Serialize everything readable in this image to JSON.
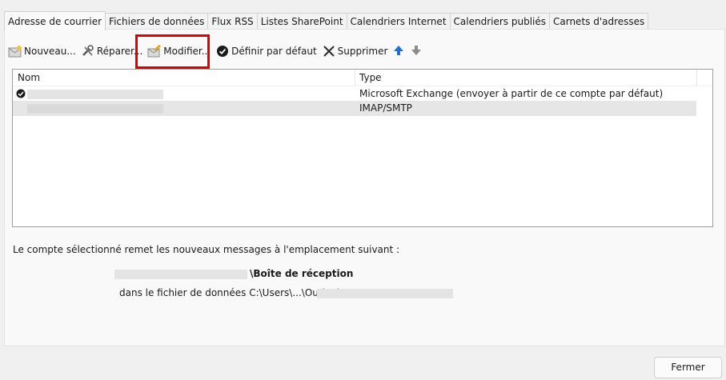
{
  "tabs": [
    {
      "label": "Adresse de courrier",
      "active": true
    },
    {
      "label": "Fichiers de données",
      "active": false
    },
    {
      "label": "Flux RSS",
      "active": false
    },
    {
      "label": "Listes SharePoint",
      "active": false
    },
    {
      "label": "Calendriers Internet",
      "active": false
    },
    {
      "label": "Calendriers publiés",
      "active": false
    },
    {
      "label": "Carnets d'adresses",
      "active": false
    }
  ],
  "toolbar": {
    "new_label": "Nouveau...",
    "repair_label": "Réparer...",
    "modify_label": "Modifier...",
    "default_label": "Définir par défaut",
    "delete_label": "Supprimer",
    "up_icon": "arrow-up-icon",
    "down_icon": "arrow-down-icon"
  },
  "accounts": {
    "columns": {
      "name": "Nom",
      "type": "Type"
    },
    "rows": [
      {
        "type": "Microsoft Exchange (envoyer à partir de ce compte par défaut)",
        "is_default": true,
        "selected": false
      },
      {
        "type": "IMAP/SMTP",
        "is_default": false,
        "selected": true
      }
    ]
  },
  "delivery": {
    "intro": "Le compte sélectionné remet les nouveaux messages à l'emplacement suivant :",
    "folder": "\\Boîte de réception",
    "file_prefix": "dans le fichier de données C:\\Users\\...\\Outlook\\"
  },
  "close_label": "Fermer",
  "colors": {
    "highlight": "#e00000",
    "accent": "#1e6fd9"
  }
}
